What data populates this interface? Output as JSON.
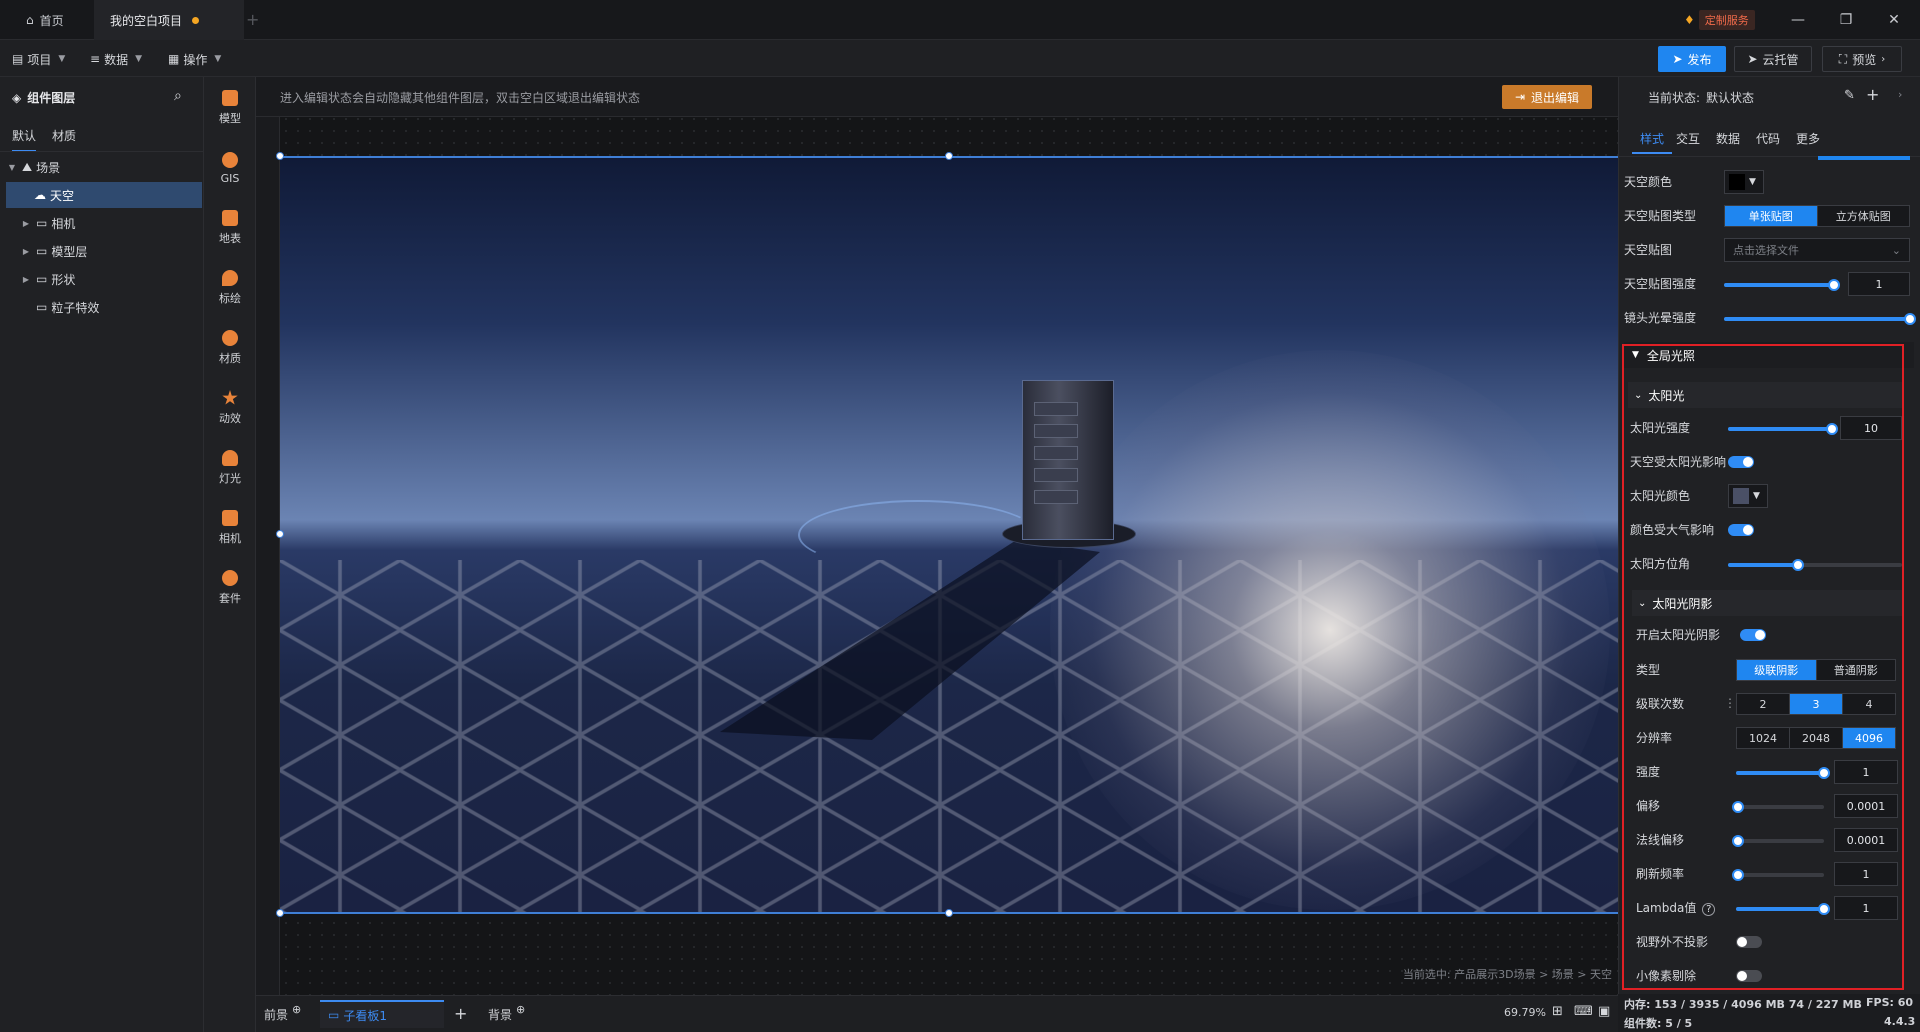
{
  "titlebar": {
    "tabs": [
      {
        "label": "首页"
      },
      {
        "label": "我的空白项目"
      }
    ],
    "custom_service": "定制服务"
  },
  "menubar": {
    "menus": [
      "项目",
      "数据",
      "操作"
    ],
    "publish": "发布",
    "cloud_host": "云托管",
    "preview": "预览"
  },
  "left": {
    "title": "组件图层",
    "tabs": [
      "默认",
      "材质"
    ],
    "tree": [
      "场景",
      "天空",
      "相机",
      "模型层",
      "形状",
      "粒子特效"
    ]
  },
  "tools": [
    "模型",
    "GIS",
    "地表",
    "标绘",
    "材质",
    "动效",
    "灯光",
    "相机",
    "套件"
  ],
  "canvas": {
    "banner": "进入编辑状态会自动隐藏其他组件图层，双击空白区域退出编辑状态",
    "exit_edit": "退出编辑",
    "breadcrumb": "当前选中: 产品展示3D场景 > 场景 > 天空"
  },
  "bottom": {
    "tabs": [
      "前景",
      "子看板1",
      "背景"
    ],
    "zoom": "69.79%"
  },
  "right": {
    "state_label": "当前状态:",
    "state_value": "默认状态",
    "tabs": [
      "样式",
      "交互",
      "数据",
      "代码",
      "更多"
    ],
    "sky": {
      "sky_color_label": "天空颜色",
      "sky_color": "#000000",
      "map_type_label": "天空贴图类型",
      "map_type_options": [
        "单张贴图",
        "立方体贴图"
      ],
      "map_label": "天空贴图",
      "map_placeholder": "点击选择文件",
      "map_intensity_label": "天空贴图强度",
      "map_intensity": "1",
      "lens_flare_label": "镜头光晕强度"
    },
    "global_light": {
      "title": "全局光照",
      "sun": {
        "title": "太阳光",
        "intensity_label": "太阳光强度",
        "intensity": "10",
        "sky_affected_label": "天空受太阳光影响",
        "color_label": "太阳光颜色",
        "color": "#4a5066",
        "atmos_label": "颜色受大气影响",
        "azimuth_label": "太阳方位角"
      },
      "shadow": {
        "title": "太阳光阴影",
        "enable_label": "开启太阳光阴影",
        "type_label": "类型",
        "type_options": [
          "级联阴影",
          "普通阴影"
        ],
        "cascade_label": "级联次数",
        "cascade_options": [
          "2",
          "3",
          "4"
        ],
        "resolution_label": "分辨率",
        "resolution_options": [
          "1024",
          "2048",
          "4096"
        ],
        "strength_label": "强度",
        "strength": "1",
        "bias_label": "偏移",
        "bias": "0.0001",
        "normal_bias_label": "法线偏移",
        "normal_bias": "0.0001",
        "refresh_label": "刷新频率",
        "refresh": "1",
        "lambda_label": "Lambda值",
        "lambda": "1",
        "no_cast_outside_label": "视野外不投影",
        "small_pixel_cull_label": "小像素剔除"
      }
    },
    "status": {
      "memory": "内存:  153 / 3935 / 4096 MB  74 / 227 MB",
      "fps": "FPS:  60",
      "components": "组件数: 5 / 5",
      "version": "4.4.3"
    }
  }
}
